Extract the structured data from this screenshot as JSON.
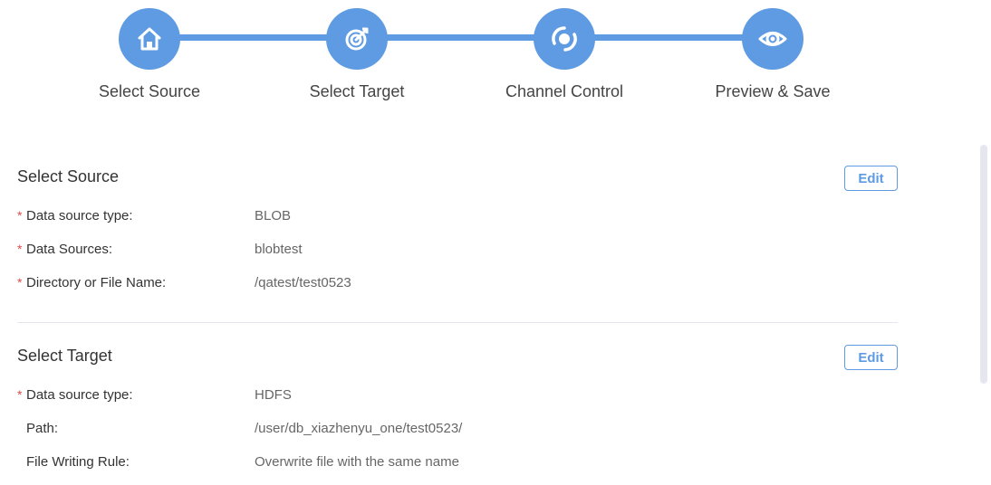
{
  "stepper": {
    "steps": [
      {
        "label": "Select Source",
        "icon": "home-icon"
      },
      {
        "label": "Select Target",
        "icon": "target-icon"
      },
      {
        "label": "Channel Control",
        "icon": "channel-control-icon"
      },
      {
        "label": "Preview & Save",
        "icon": "eye-icon"
      }
    ],
    "accent_color": "#5e9be2"
  },
  "source_section": {
    "title": "Select Source",
    "edit_label": "Edit",
    "fields": [
      {
        "label": "Data source type:",
        "value": "BLOB",
        "required": true
      },
      {
        "label": "Data Sources:",
        "value": "blobtest",
        "required": true
      },
      {
        "label": "Directory or File Name:",
        "value": "/qatest/test0523",
        "required": true
      }
    ]
  },
  "target_section": {
    "title": "Select Target",
    "edit_label": "Edit",
    "fields": [
      {
        "label": "Data source type:",
        "value": "HDFS",
        "required": true
      },
      {
        "label": "Path:",
        "value": "/user/db_xiazhenyu_one/test0523/",
        "required": false
      },
      {
        "label": "File Writing Rule:",
        "value": "Overwrite file with the same name",
        "required": false
      }
    ]
  },
  "required_marker": "*"
}
